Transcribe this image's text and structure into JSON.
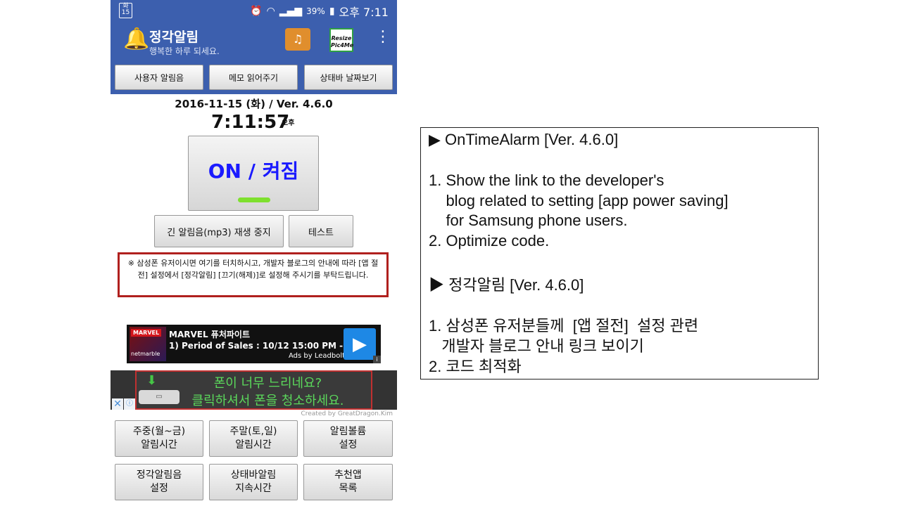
{
  "status_bar": {
    "calendar_day": "화",
    "calendar_date": "15",
    "battery": "39%",
    "time": "오후 7:11"
  },
  "app_bar": {
    "title": "정각알림",
    "subtitle": "행복한 하루 되세요.",
    "resize_icon_label": "Resize\nPic4Me"
  },
  "top_buttons": [
    "사용자 알림음",
    "메모 읽어주기",
    "상태바 날짜보기"
  ],
  "main": {
    "date_version": "2016-11-15 (화) / Ver. 4.6.0",
    "clock": "7:11:57",
    "ampm": "오후",
    "toggle_label": "ON / 켜짐",
    "stop_button": "긴 알림음(mp3) 재생 중지",
    "test_button": "테스트",
    "notice": "※ 삼성폰 유저이시면 여기를 터치하시고, 개발자 블로그의 안내에 따라 [앱 절전] 설정에서 [정각알림] [끄기(해제)]로 설정해 주시기를 부탁드립니다."
  },
  "ad_banner": {
    "brand": "MARVEL",
    "publisher": "netmarble",
    "title": "MARVEL 퓨처파이트",
    "line": "1) Period of Sales : 10/12 15:00 PM -",
    "by": "Ads by Leadbolt"
  },
  "ad_cleaner": {
    "line1": "폰이 너무 느리네요?",
    "line2": "클릭하셔서 폰을 청소하세요."
  },
  "credit": "Created by GreatDragon.Kim",
  "grid_buttons": [
    "주중(월~금)\n알림시간",
    "주말(토,일)\n알림시간",
    "알림볼륨\n설정",
    "정각알림음\n설정",
    "상태바알림\n지속시간",
    "추천앱\n목록"
  ],
  "release_notes": [
    "▶ OnTimeAlarm [Ver. 4.6.0]",
    "1. Show the link to the developer's",
    "    blog related to setting [app power saving]",
    "    for Samsung phone users.",
    "2. Optimize code.",
    "▶ 정각알림 [Ver. 4.6.0]",
    "1. 삼성폰 유저분들께  [앱 절전]  설정 관련",
    "   개발자 블로그 안내 링크 보이기",
    "2. 코드 최적화"
  ]
}
